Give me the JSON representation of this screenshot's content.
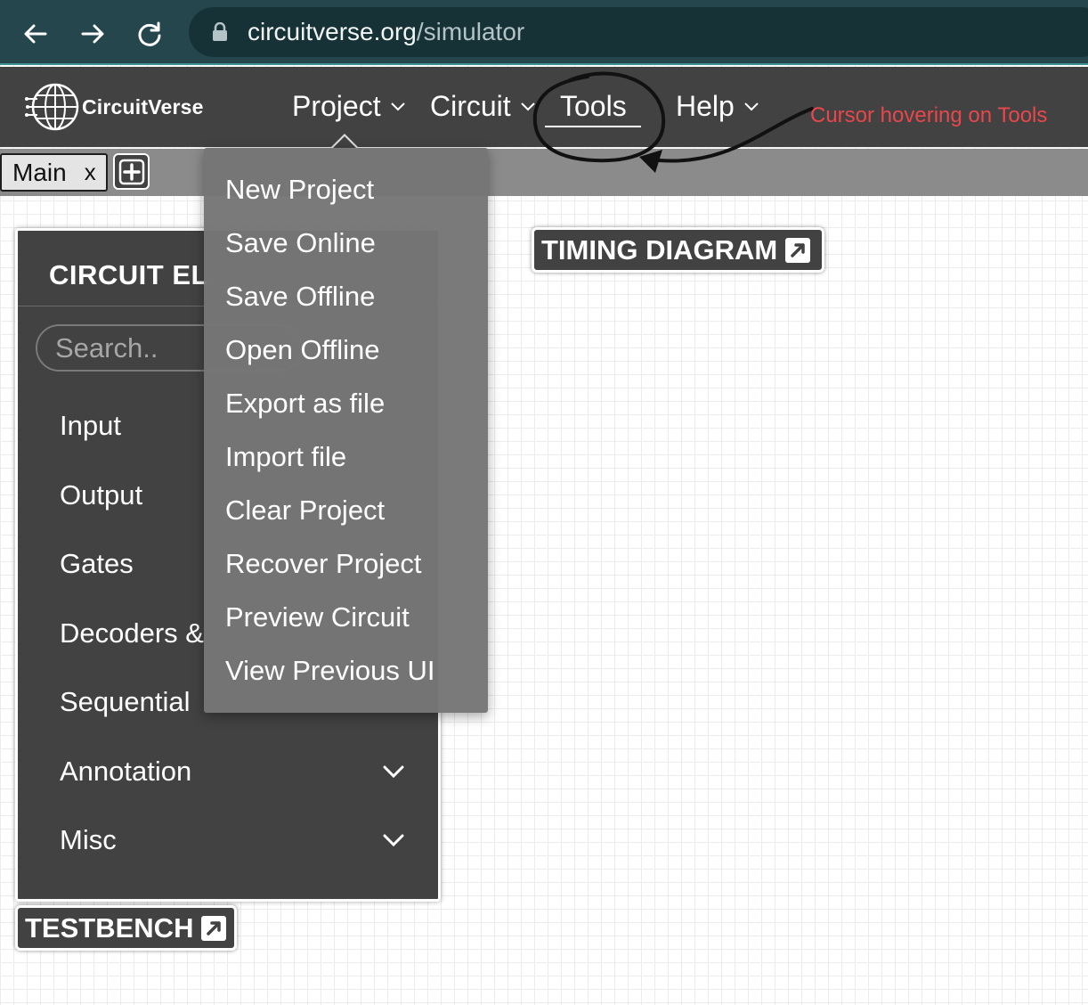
{
  "browser": {
    "url_host": "circuitverse.org",
    "url_path": "/simulator",
    "icons": [
      "back-arrow-icon",
      "forward-arrow-icon",
      "reload-icon",
      "lock-icon"
    ]
  },
  "navbar": {
    "brand": "CircuitVerse",
    "menus": [
      {
        "label": "Project",
        "has_dropdown": true
      },
      {
        "label": "Circuit",
        "has_dropdown": true
      },
      {
        "label": "Tools",
        "has_dropdown": false
      },
      {
        "label": "Help",
        "has_dropdown": true
      }
    ]
  },
  "annotation": {
    "text": "Cursor hovering on Tools",
    "color": "#e8474b"
  },
  "tabs": {
    "items": [
      {
        "label": "Main",
        "close": "x"
      }
    ],
    "add_icon": "plus-square-icon"
  },
  "elements_panel": {
    "title": "CIRCUIT EL",
    "search_placeholder": "Search..",
    "categories": [
      "Input",
      "Output",
      "Gates",
      "Decoders &",
      "Sequential",
      "Annotation",
      "Misc"
    ]
  },
  "project_dropdown": {
    "items": [
      "New Project",
      "Save Online",
      "Save Offline",
      "Open Offline",
      "Export as file",
      "Import file",
      "Clear Project",
      "Recover Project",
      "Preview Circuit",
      "View Previous UI"
    ]
  },
  "buttons": {
    "timing_diagram": "TIMING DIAGRAM",
    "testbench": "TESTBENCH"
  },
  "colors": {
    "browser_bar": "#24464c",
    "app_navbar": "#424242",
    "tab_bar": "#8b8b8b",
    "dropdown": "#767676",
    "panel": "#424242"
  }
}
